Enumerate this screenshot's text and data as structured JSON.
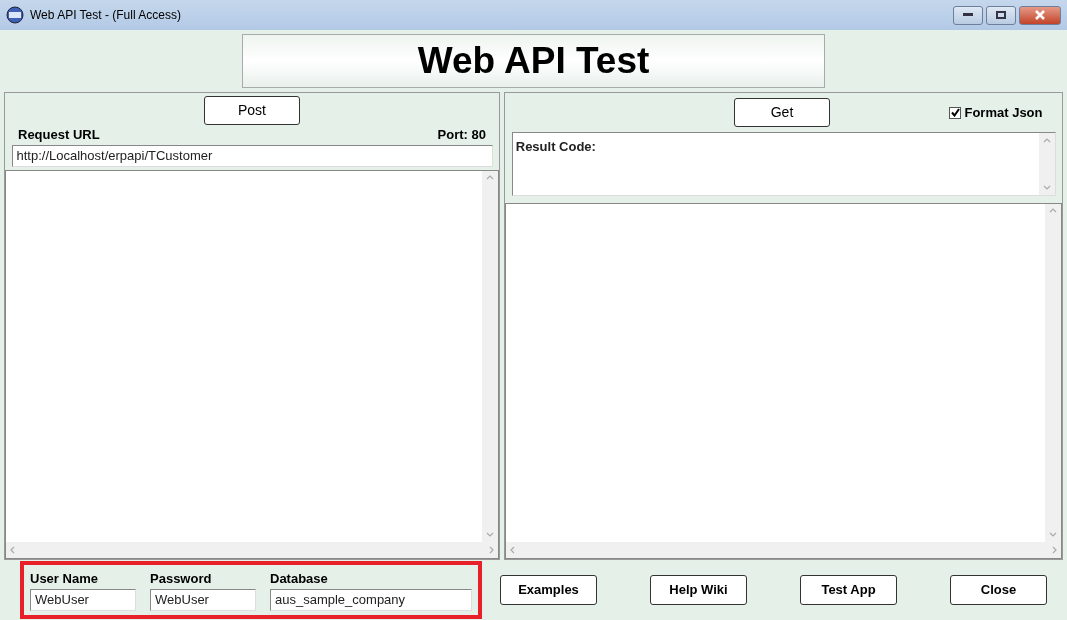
{
  "window": {
    "title": "Web API Test - (Full Access)"
  },
  "banner": {
    "title": "Web API Test"
  },
  "left": {
    "post_button": "Post",
    "url_label": "Request URL",
    "port": "Port: 80",
    "url": "http://Localhost/erpapi/TCustomer"
  },
  "right": {
    "get_button": "Get",
    "format_json": {
      "label": "Format Json",
      "checked": true
    },
    "result_label": "Result Code:"
  },
  "credentials": {
    "highlighted": true,
    "fields": [
      {
        "label": "User Name",
        "value": "WebUser"
      },
      {
        "label": "Password",
        "value": "WebUser"
      },
      {
        "label": "Database",
        "value": "aus_sample_company"
      }
    ]
  },
  "buttons": [
    "Examples",
    "Help Wiki",
    "Test App",
    "Close"
  ]
}
